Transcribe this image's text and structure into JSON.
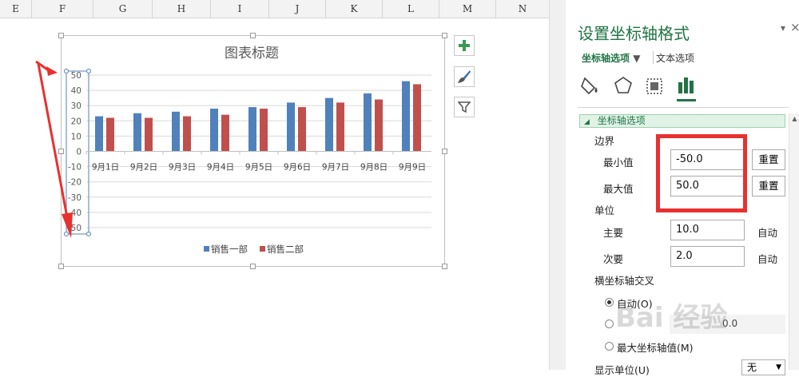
{
  "sheet": {
    "columns": [
      "E",
      "F",
      "G",
      "H",
      "I",
      "J",
      "K",
      "L",
      "M",
      "N"
    ]
  },
  "chart": {
    "side_buttons": [
      "plus-icon",
      "brush-icon",
      "filter-icon"
    ]
  },
  "chart_data": {
    "type": "bar",
    "title": "图表标题",
    "categories": [
      "9月1日",
      "9月2日",
      "9月3日",
      "9月4日",
      "9月5日",
      "9月6日",
      "9月7日",
      "9月8日",
      "9月9日"
    ],
    "series": [
      {
        "name": "销售一部",
        "values": [
          23,
          25,
          26,
          28,
          29,
          32,
          35,
          38,
          46
        ],
        "color": "#4f81bd"
      },
      {
        "name": "销售二部",
        "values": [
          22,
          22,
          23,
          24,
          28,
          29,
          32,
          34,
          44
        ],
        "color": "#c0504d"
      }
    ],
    "yticks": [
      "50",
      "40",
      "30",
      "20",
      "10",
      "0",
      "-10",
      "-20",
      "-30",
      "-40",
      "-50"
    ],
    "ylim": [
      -50,
      50
    ],
    "grid": true,
    "legend": "bottom"
  },
  "pane": {
    "title": "设置坐标轴格式",
    "tab_axis": "坐标轴选项",
    "tab_text": "文本选项",
    "section": "坐标轴选项",
    "bounds_label": "边界",
    "min_label": "最小值",
    "min_value": "-50.0",
    "max_label": "最大值",
    "max_value": "50.0",
    "reset": "重置",
    "units_label": "单位",
    "major_label": "主要",
    "major_value": "10.0",
    "minor_label": "次要",
    "minor_value": "2.0",
    "auto": "自动",
    "cross_label": "横坐标轴交叉",
    "radio_auto": "自动(O)",
    "radio_value_value": "0.0",
    "radio_max": "最大坐标轴值(M)",
    "display_units": "显示单位(U)",
    "display_units_value": "无",
    "watermark": "Bai 经验"
  },
  "annotation": {
    "arrow_color": "#e8312f",
    "highlight_color": "#e8312f"
  }
}
